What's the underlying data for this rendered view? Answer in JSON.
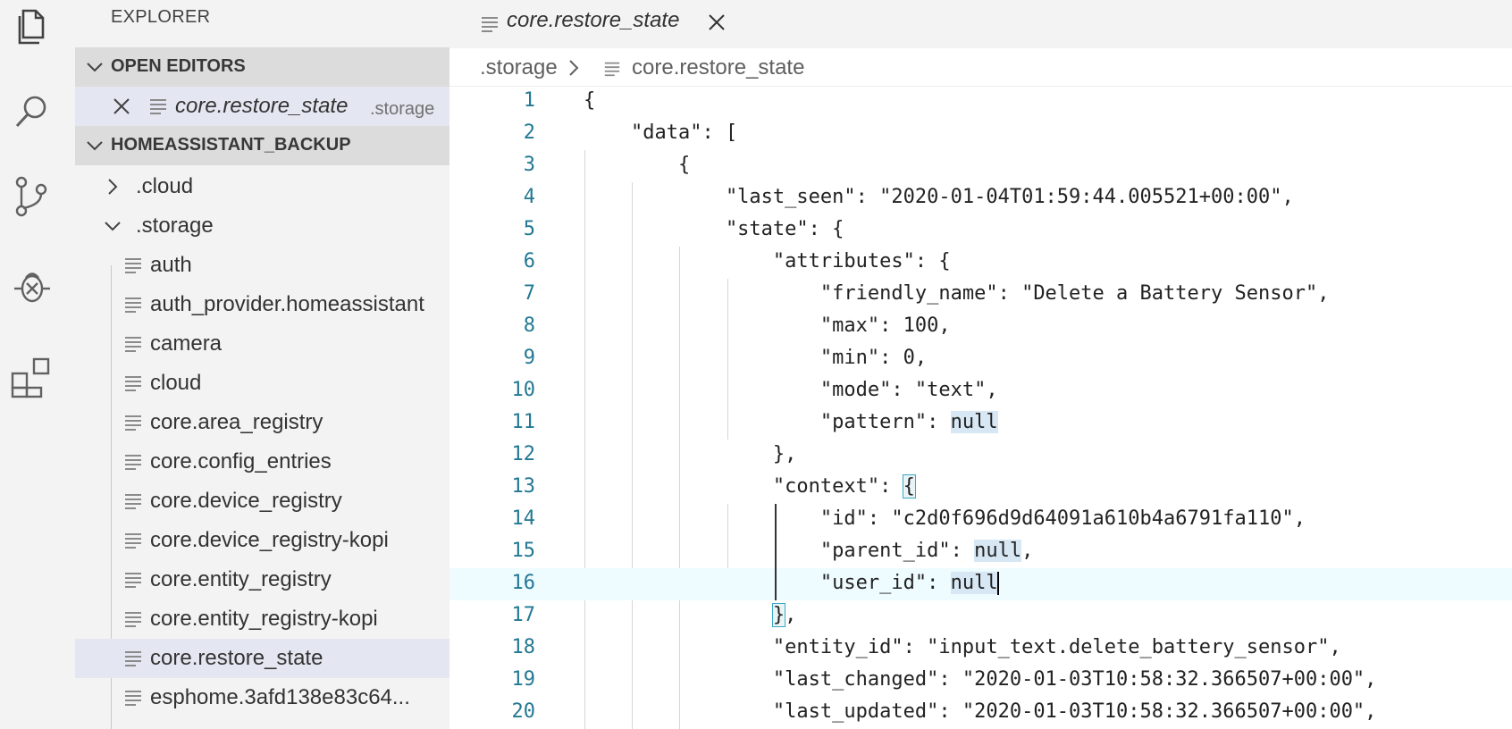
{
  "sidebar": {
    "title": "EXPLORER",
    "open_editors": {
      "header": "OPEN EDITORS",
      "items": [
        {
          "name": "core.restore_state",
          "folder": ".storage"
        }
      ]
    },
    "workspace": {
      "header": "HOMEASSISTANT_BACKUP",
      "folders": [
        {
          "name": ".cloud",
          "expanded": false
        },
        {
          "name": ".storage",
          "expanded": true
        }
      ],
      "files": [
        "auth",
        "auth_provider.homeassistant",
        "camera",
        "cloud",
        "core.area_registry",
        "core.config_entries",
        "core.device_registry",
        "core.device_registry-kopi",
        "core.entity_registry",
        "core.entity_registry-kopi",
        "core.restore_state",
        "esphome.3afd138e83c64..."
      ],
      "active_file": "core.restore_state"
    }
  },
  "editor": {
    "tab": {
      "label": "core.restore_state"
    },
    "breadcrumb": {
      "folder": ".storage",
      "file": "core.restore_state"
    },
    "current_line": 16,
    "lines": [
      {
        "n": "1",
        "text": "{"
      },
      {
        "n": "2",
        "text": "    \"data\": ["
      },
      {
        "n": "3",
        "text": "        {"
      },
      {
        "n": "4",
        "text": "            \"last_seen\": \"2020-01-04T01:59:44.005521+00:00\","
      },
      {
        "n": "5",
        "text": "            \"state\": {"
      },
      {
        "n": "6",
        "text": "                \"attributes\": {"
      },
      {
        "n": "7",
        "text": "                    \"friendly_name\": \"Delete a Battery Sensor\","
      },
      {
        "n": "8",
        "text": "                    \"max\": 100,"
      },
      {
        "n": "9",
        "text": "                    \"min\": 0,"
      },
      {
        "n": "10",
        "text": "                    \"mode\": \"text\","
      },
      {
        "n": "11",
        "pre": "                    \"pattern\": ",
        "hl": "null",
        "post": ""
      },
      {
        "n": "12",
        "text": "                },"
      },
      {
        "n": "13",
        "pre": "                \"context\": ",
        "bracket": "{",
        "post": ""
      },
      {
        "n": "14",
        "text": "                    \"id\": \"c2d0f696d9d64091a610b4a6791fa110\","
      },
      {
        "n": "15",
        "pre": "                    \"parent_id\": ",
        "hl": "null",
        "post": ","
      },
      {
        "n": "16",
        "pre": "                    \"user_id\": ",
        "hl": "null",
        "post": ""
      },
      {
        "n": "17",
        "pre": "                ",
        "bracket": "}",
        "post": ","
      },
      {
        "n": "18",
        "text": "                \"entity_id\": \"input_text.delete_battery_sensor\","
      },
      {
        "n": "19",
        "text": "                \"last_changed\": \"2020-01-03T10:58:32.366507+00:00\","
      },
      {
        "n": "20",
        "text": "                \"last_updated\": \"2020-01-03T10:58:32.366507+00:00\","
      }
    ]
  },
  "icons": {
    "activity": [
      "files-icon",
      "search-icon",
      "source-control-icon",
      "debug-icon",
      "extensions-icon"
    ]
  },
  "colors": {
    "line_number": "#237893",
    "current_line_bg": "#eefbff",
    "selection_highlight": "#d7e7f3",
    "sidebar_bg": "#f3f3f3"
  }
}
